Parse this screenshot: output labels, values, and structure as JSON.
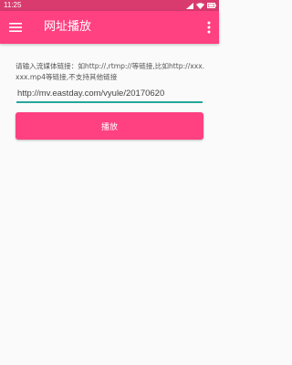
{
  "status_bar": {
    "time": "11:25",
    "icons": [
      "signal-icon",
      "wifi-icon",
      "battery-icon"
    ]
  },
  "toolbar": {
    "title": "网址播放",
    "menu_icon": "menu-icon",
    "overflow_icon": "more-vert-icon",
    "background_color": "#ff4081"
  },
  "form": {
    "hint_text": "请输入流媒体链接：如http://,rtmp://等链接,比如http://xxx.xxx.mp4等链接,不支持其他链接",
    "url_value": "http://mv.eastday.com/vyule/20170620",
    "play_button_label": "播放",
    "accent_color": "#26a69a"
  }
}
